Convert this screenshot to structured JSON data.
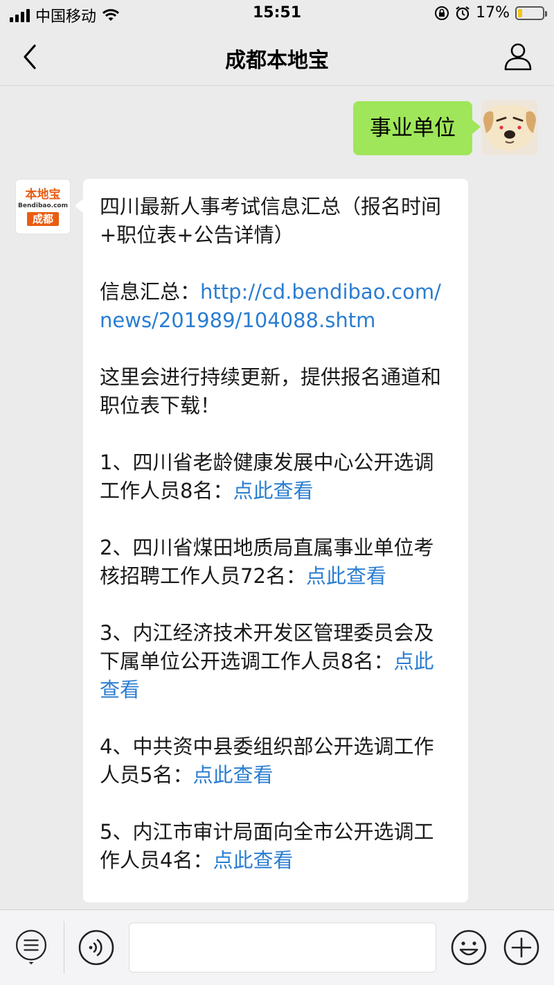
{
  "status_bar": {
    "carrier": "中国移动",
    "time": "15:51",
    "battery_percent": "17%",
    "battery_level": 0.17,
    "icons": [
      "signal-icon",
      "wifi-icon",
      "rotation-lock-icon",
      "alarm-icon",
      "battery-icon"
    ]
  },
  "nav": {
    "title": "成都本地宝",
    "icons": [
      "back-chevron-icon",
      "profile-person-icon"
    ]
  },
  "chat": {
    "outgoing": {
      "text": "事业单位"
    },
    "incoming": {
      "avatar": {
        "brand": "本地宝",
        "site": "Bendibao.com",
        "city": "成都"
      },
      "title": "四川最新人事考试信息汇总（报名时间+职位表+公告详情）",
      "summary_label": "信息汇总：",
      "summary_link": "http://cd.bendibao.com/news/201989/104088.shtm",
      "update_note": "这里会进行持续更新，提供报名通道和职位表下载！",
      "items": [
        {
          "text": "1、四川省老龄健康发展中心公开选调工作人员8名：",
          "link": "点此查看"
        },
        {
          "text": "2、四川省煤田地质局直属事业单位考核招聘工作人员72名：",
          "link": "点此查看"
        },
        {
          "text": "3、内江经济技术开发区管理委员会及下属单位公开选调工作人员8名：",
          "link": "点此查看"
        },
        {
          "text": "4、中共资中县委组织部公开选调工作人员5名：",
          "link": "点此查看"
        },
        {
          "text": "5、内江市审计局面向全市公开选调工作人员4名：",
          "link": "点此查看"
        }
      ]
    }
  },
  "input_bar": {
    "icons": [
      "menu-list-icon",
      "voice-icon",
      "emoji-icon",
      "plus-icon"
    ],
    "input_value": ""
  },
  "colors": {
    "background": "#ebebeb",
    "outgoing_bubble": "#9fe65a",
    "incoming_bubble": "#ffffff",
    "link": "#2a7dd1",
    "brand_orange": "#e85d13",
    "battery_fill": "#f5c518"
  }
}
